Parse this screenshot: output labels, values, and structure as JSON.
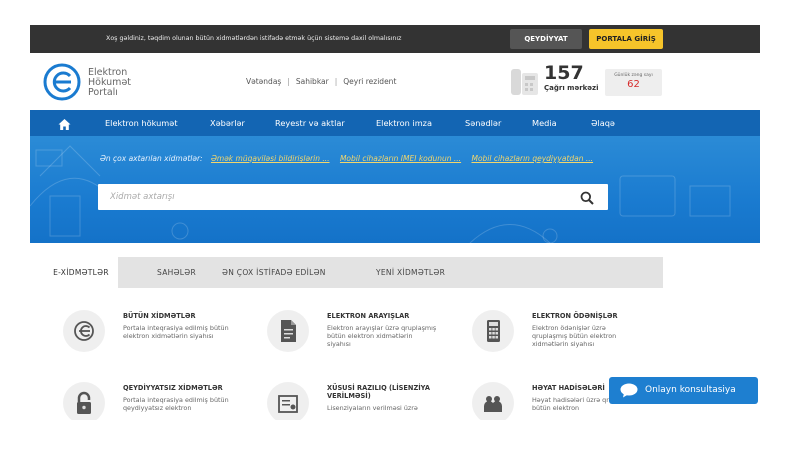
{
  "topbar": {
    "welcome": "Xoş gəldiniz, təqdim olunan bütün xidmətlərdən istifadə etmək üçün sistemə daxil olmalısınız",
    "register": "QEYDİYYAT",
    "login": "PORTALA GİRİŞ"
  },
  "header": {
    "logo_lines": [
      "Elektron",
      "Hökumət",
      "Portalı"
    ],
    "user_types": [
      "Vətəndaş",
      "Sahibkar",
      "Qeyri rezident"
    ],
    "call_number": "157",
    "call_label": "Çağrı mərkəzi",
    "daily_label": "Günlük zəng sayı",
    "daily_count": "62"
  },
  "nav": {
    "items": [
      "Elektron hökumət",
      "Xəbərlər",
      "Reyestr və aktlar",
      "Elektron imza",
      "Sənədlər",
      "Media",
      "Əlaqə"
    ]
  },
  "hero": {
    "popular_label": "Ən çox axtarılan xidmətlər:",
    "popular_links": [
      "Əmək müqaviləsi bildirişlərin ...",
      "Mobil cihazların IMEI kodunun ...",
      "Mobil cihazların qeydiyyatdan ..."
    ],
    "search_placeholder": "Xidmət axtarışı"
  },
  "tabs": [
    "E-XİDMƏTLƏR",
    "SAHƏLƏR",
    "ƏN ÇOX İSTİFADƏ EDİLƏN",
    "YENİ XİDMƏTLƏR"
  ],
  "services": [
    {
      "title": "BÜTÜN XİDMƏTLƏR",
      "desc": "Portala inteqrasiya edilmiş bütün elektron xidmətlərin siyahısı",
      "icon": "e-logo-icon"
    },
    {
      "title": "ELEKTRON ARAYIŞLAR",
      "desc": "Elektron arayışlar üzrə qruplaşmış bütün elektron xidmətlərin siyahısı",
      "icon": "document-icon"
    },
    {
      "title": "ELEKTRON ÖDƏNİŞLƏR",
      "desc": "Elektron ödənişlər üzrə qruplaşmış bütün elektron xidmətlərin siyahısı",
      "icon": "calculator-icon"
    },
    {
      "title": "QEYDİYYATSIZ XİDMƏTLƏR",
      "desc": "Portala inteqrasiya edilmiş bütün qeydiyyatsız elektron",
      "icon": "lock-icon"
    },
    {
      "title": "XÜSUSİ RAZILIQ (LİSENZİYA VERİLMƏSİ)",
      "desc": "Lisenziyaların verilməsi üzrə",
      "icon": "certificate-icon"
    },
    {
      "title": "HƏYAT HADİSƏLƏRİ",
      "desc": "Həyat hadisələri üzrə qruplaşmış bütün elektron",
      "icon": "family-icon"
    }
  ],
  "consult": {
    "label": "Onlayn konsultasiya"
  }
}
